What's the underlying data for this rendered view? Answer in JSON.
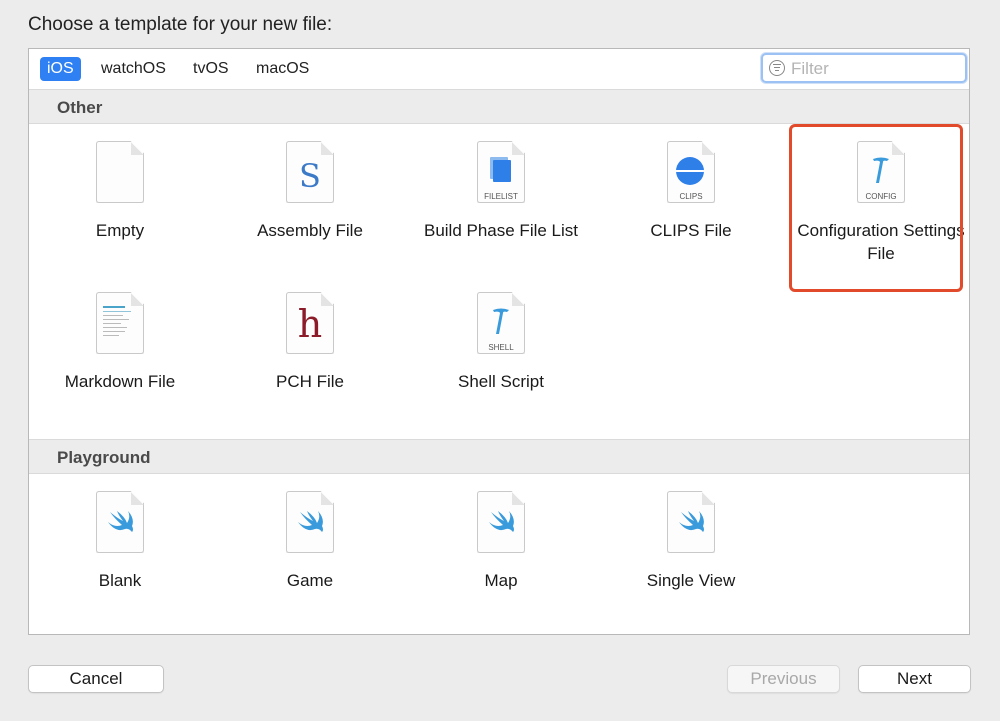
{
  "heading": "Choose a template for your new file:",
  "platform_tabs": [
    {
      "label": "iOS",
      "active": true
    },
    {
      "label": "watchOS",
      "active": false
    },
    {
      "label": "tvOS",
      "active": false
    },
    {
      "label": "macOS",
      "active": false
    }
  ],
  "filter": {
    "placeholder": "Filter",
    "value": ""
  },
  "sections": [
    {
      "title": "Other",
      "items": [
        {
          "label": "Empty",
          "icon": "empty-file-icon"
        },
        {
          "label": "Assembly File",
          "icon": "assembly-file-icon",
          "glyph": "S"
        },
        {
          "label": "Build Phase File List",
          "icon": "filelist-icon",
          "caption": "FILELIST"
        },
        {
          "label": "CLIPS File",
          "icon": "clips-file-icon",
          "caption": "CLIPS"
        },
        {
          "label": "Configuration Settings File",
          "icon": "config-file-icon",
          "caption": "CONFIG",
          "selected": true
        },
        {
          "label": "Markdown File",
          "icon": "markdown-file-icon"
        },
        {
          "label": "PCH File",
          "icon": "pch-file-icon",
          "glyph": "h"
        },
        {
          "label": "Shell Script",
          "icon": "shell-script-icon",
          "caption": "SHELL"
        }
      ]
    },
    {
      "title": "Playground",
      "items": [
        {
          "label": "Blank",
          "icon": "swift-playground-icon"
        },
        {
          "label": "Game",
          "icon": "swift-playground-icon"
        },
        {
          "label": "Map",
          "icon": "swift-playground-icon"
        },
        {
          "label": "Single View",
          "icon": "swift-playground-icon"
        }
      ]
    }
  ],
  "buttons": {
    "cancel": "Cancel",
    "previous": "Previous",
    "next": "Next"
  },
  "colors": {
    "accent": "#2f80f3",
    "selection_outline": "#e14a2a",
    "swift": "#3a9bdc"
  }
}
